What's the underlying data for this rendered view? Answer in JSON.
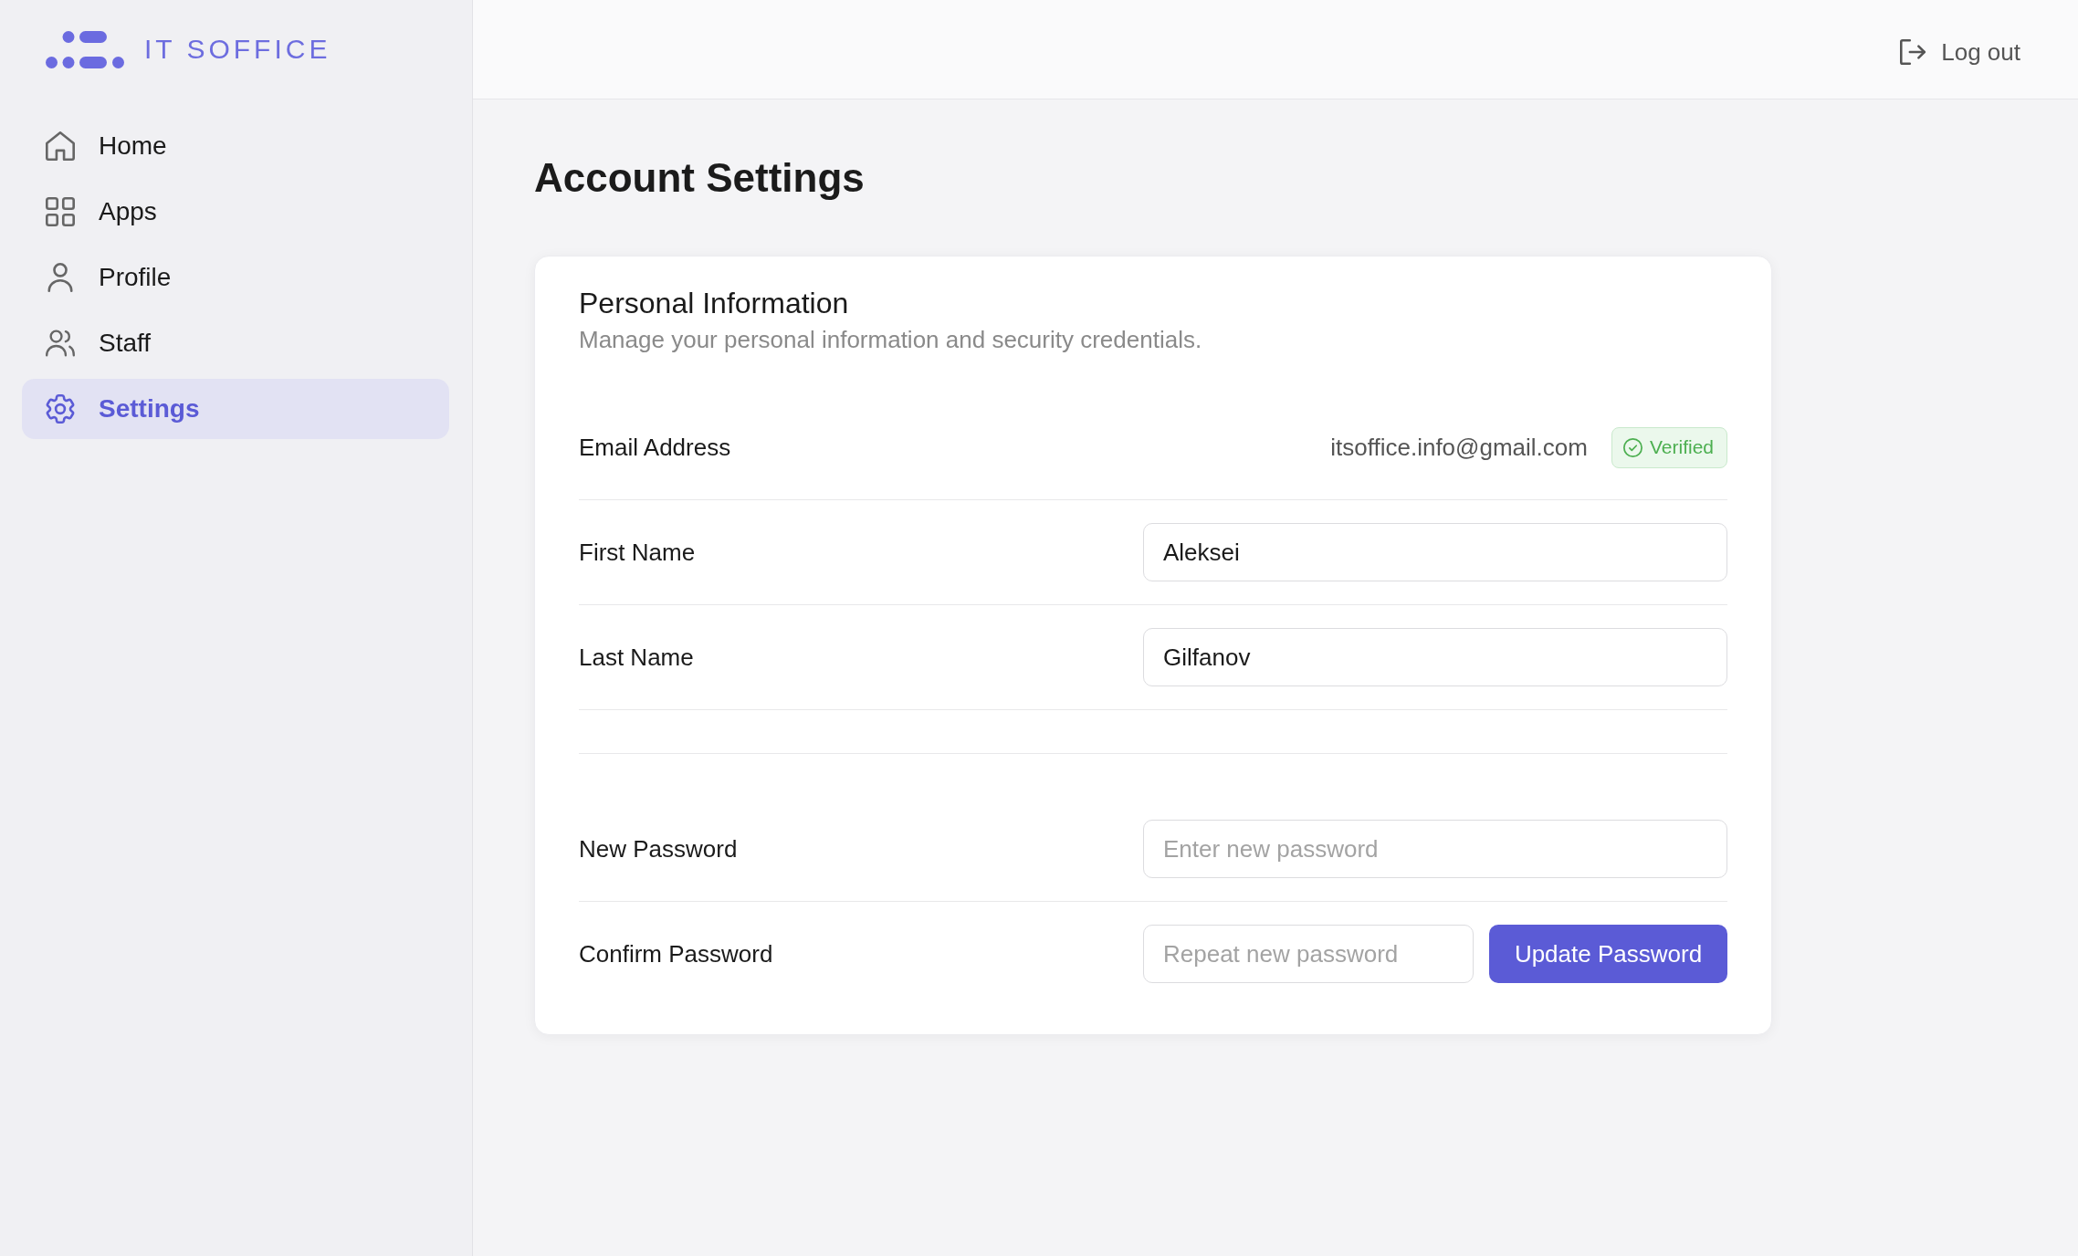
{
  "sidebar": {
    "logo": {
      "text": "IT SOFFICE"
    },
    "items": [
      {
        "label": "Home",
        "selected": false
      },
      {
        "label": "Apps",
        "selected": false
      },
      {
        "label": "Profile",
        "selected": false
      },
      {
        "label": "Staff",
        "selected": false
      },
      {
        "label": "Settings",
        "selected": true
      }
    ]
  },
  "header": {
    "logout": {
      "label": "Log out"
    }
  },
  "page": {
    "title": "Account Settings"
  },
  "card": {
    "title": "Personal Information",
    "subtitle": "Manage your personal information and security credentials.",
    "sections": [
      {
        "fields": [
          {
            "kind": "readonly",
            "label": "Email Address",
            "value": "itsoffice.info@gmail.com",
            "badge": "Verified"
          },
          {
            "kind": "input",
            "label": "First Name",
            "value": "Aleksei"
          },
          {
            "kind": "input",
            "label": "Last Name",
            "value": "Gilfanov"
          }
        ]
      },
      {
        "fields": [
          {
            "kind": "input",
            "label": "New Password",
            "placeholder": "Enter new password"
          },
          {
            "kind": "input_button",
            "label": "Confirm Password",
            "placeholder": "Repeat new password",
            "button": "Update Password"
          }
        ]
      }
    ]
  }
}
